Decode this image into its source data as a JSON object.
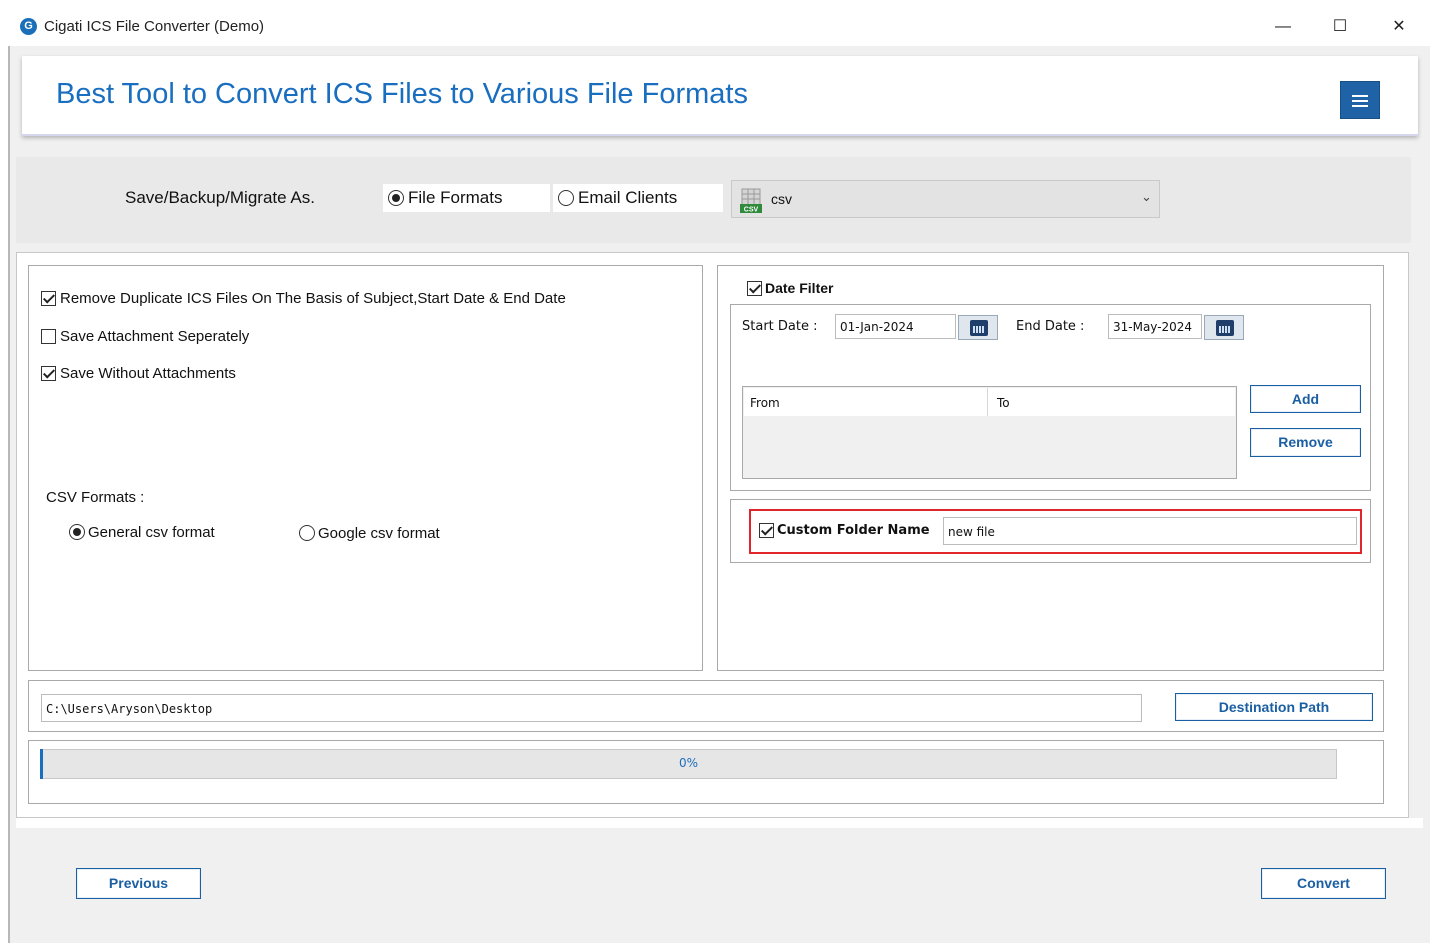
{
  "window": {
    "title": "Cigati ICS File Converter (Demo)",
    "icon_letter": "G",
    "controls": [
      "—",
      "☐",
      "✕"
    ]
  },
  "header": {
    "title": "Best Tool to Convert ICS Files to Various File Formats",
    "menu_icon": "hamburger-menu-icon"
  },
  "save_as": {
    "label": "Save/Backup/Migrate As.",
    "options": [
      {
        "label": "File Formats",
        "selected": true
      },
      {
        "label": "Email Clients",
        "selected": false
      }
    ],
    "format_selected": "csv",
    "format_icon_text": "CSV"
  },
  "options": {
    "remove_duplicates": {
      "label": "Remove Duplicate ICS Files On The Basis of Subject,Start Date & End Date",
      "checked": true
    },
    "save_attachment_separately": {
      "label": "Save Attachment Seperately",
      "checked": false
    },
    "save_without_attachments": {
      "label": "Save Without Attachments",
      "checked": true
    }
  },
  "csv_formats": {
    "label": "CSV Formats :",
    "options": [
      {
        "label": "General csv format",
        "selected": true
      },
      {
        "label": "Google csv format",
        "selected": false
      }
    ]
  },
  "date_filter": {
    "label": "Date Filter",
    "checked": true,
    "start_label": "Start Date :",
    "start_value": "01-Jan-2024",
    "end_label": "End Date :",
    "end_value": "31-May-2024",
    "table_columns": [
      "From",
      "To"
    ],
    "add_label": "Add",
    "remove_label": "Remove"
  },
  "custom_folder": {
    "label": "Custom Folder Name",
    "checked": true,
    "value": "new file"
  },
  "destination": {
    "path": "C:\\Users\\Aryson\\Desktop",
    "button_label": "Destination Path"
  },
  "progress": {
    "percent": 0,
    "text": "0%"
  },
  "footer": {
    "previous_label": "Previous",
    "convert_label": "Convert"
  },
  "colors": {
    "accent": "#1a6ebf",
    "highlight_border": "#e0262b"
  }
}
